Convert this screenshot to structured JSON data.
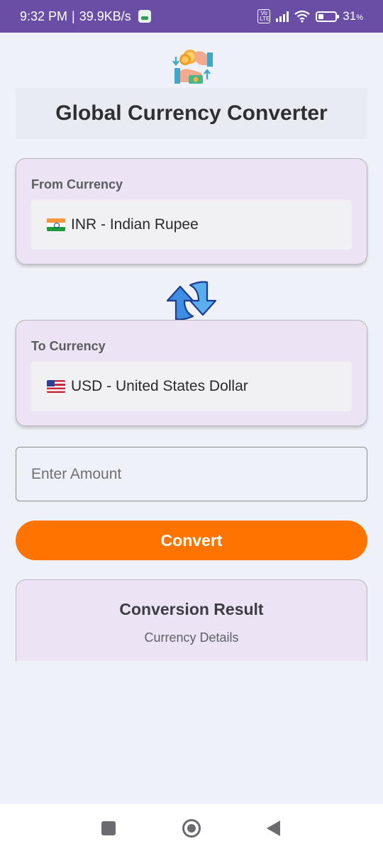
{
  "status_bar": {
    "time": "9:32 PM",
    "separator": "|",
    "speed": "39.9KB/s",
    "volte": "Vo LTE",
    "battery": "31",
    "battery_unit": "%"
  },
  "header": {
    "logo_icon": "currency-exchange-icon",
    "title": "Global Currency Converter"
  },
  "from_currency": {
    "label": "From Currency",
    "flag": "india-flag-icon",
    "value": "INR - Indian Rupee"
  },
  "swap": {
    "icon": "swap-arrows-icon"
  },
  "to_currency": {
    "label": "To Currency",
    "flag": "us-flag-icon",
    "value": "USD - United States Dollar"
  },
  "amount": {
    "placeholder": "Enter Amount",
    "value": ""
  },
  "convert": {
    "label": "Convert"
  },
  "result": {
    "title": "Conversion Result",
    "details": "Currency Details"
  },
  "nav": {
    "recents_icon": "square-recents-icon",
    "home_icon": "circle-home-icon",
    "back_icon": "triangle-back-icon"
  },
  "colors": {
    "status_bar": "#6a4ea6",
    "background": "#eff1f8",
    "card": "#ece4f5",
    "accent": "#ff7400"
  }
}
